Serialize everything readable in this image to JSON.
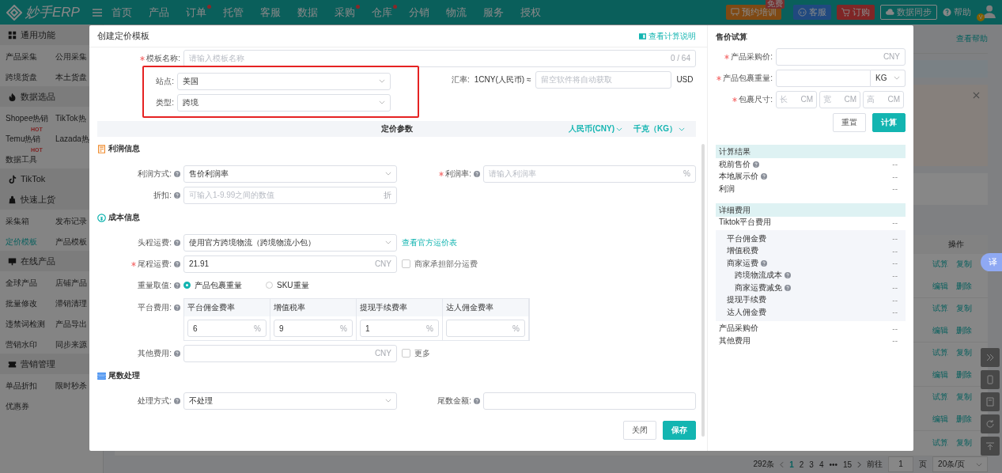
{
  "topbar": {
    "logo": "妙手ERP",
    "nav": [
      {
        "label": "首页",
        "dot": false
      },
      {
        "label": "产品",
        "dot": false
      },
      {
        "label": "订单",
        "dot": true
      },
      {
        "label": "托管",
        "dot": false
      },
      {
        "label": "客服",
        "dot": false
      },
      {
        "label": "数据",
        "dot": false
      },
      {
        "label": "采购",
        "dot": true
      },
      {
        "label": "仓库",
        "dot": true
      },
      {
        "label": "分销",
        "dot": false
      },
      {
        "label": "物流",
        "dot": false
      },
      {
        "label": "服务",
        "dot": false
      },
      {
        "label": "授权",
        "dot": false
      }
    ],
    "training": {
      "label": "预约培训",
      "badge": "免费"
    },
    "service": "客服",
    "order": "订购",
    "sync": "数据同步",
    "help": "帮助",
    "avatar_badge": "V"
  },
  "sidebar": [
    {
      "title": "通用功能",
      "items": [
        {
          "label": "产品采集",
          "selected": false
        },
        {
          "label": "公用采集",
          "selected": false
        },
        {
          "label": "跨境货盘",
          "selected": false
        },
        {
          "label": "本土货盘",
          "selected": false
        }
      ]
    },
    {
      "title": "数据选品",
      "items": [
        {
          "label": "Shopee热销",
          "selected": false
        },
        {
          "label": "TikTok热",
          "selected": false
        },
        {
          "label": "Temu热销",
          "selected": false,
          "badge": "HOT"
        },
        {
          "label": "Lazada热",
          "selected": false
        },
        {
          "label": "数据工具",
          "selected": false,
          "badge": "HOT"
        }
      ]
    },
    {
      "title": "TikTok"
    },
    {
      "title": "快速上货",
      "items": [
        {
          "label": "采集箱",
          "selected": false
        },
        {
          "label": "发布记录",
          "selected": false
        },
        {
          "label": "定价模板",
          "selected": true
        },
        {
          "label": "产品模板",
          "selected": false
        }
      ]
    },
    {
      "title": "在线产品",
      "items": [
        {
          "label": "全球产品",
          "selected": false
        },
        {
          "label": "店铺产品",
          "selected": false
        },
        {
          "label": "批量修改",
          "selected": false
        },
        {
          "label": "滞销清理",
          "selected": false
        },
        {
          "label": "违禁词检测",
          "selected": false
        },
        {
          "label": "产品导出",
          "selected": false
        },
        {
          "label": "营销水印",
          "selected": false
        },
        {
          "label": "同步来源",
          "selected": false
        }
      ]
    },
    {
      "title": "营销管理",
      "items": [
        {
          "label": "单品折扣",
          "selected": false
        },
        {
          "label": "限时秒杀",
          "selected": false
        },
        {
          "label": "优惠券",
          "selected": false
        }
      ]
    }
  ],
  "background": {
    "help_link": "查看帮助",
    "action_header": "操作",
    "rows": [
      {
        "actions": [
          "试算",
          "复制",
          "编辑",
          "删除"
        ]
      },
      {
        "actions": [
          "试算",
          "复制",
          "编辑",
          "删除"
        ]
      },
      {
        "actions": [
          "试算",
          "复制",
          "编辑",
          "删除"
        ]
      },
      {
        "actions": [
          "试算",
          "复制",
          "编辑",
          "删除"
        ]
      },
      {
        "actions": [
          "试算",
          "复制"
        ]
      }
    ],
    "pagination": {
      "total": "292条",
      "pages": [
        {
          "label": "1",
          "selected": true
        },
        {
          "label": "2",
          "selected": false
        },
        {
          "label": "3",
          "selected": false
        },
        {
          "label": "4",
          "selected": false
        }
      ],
      "ellipsis": "•••",
      "last": "15",
      "goto": "前往",
      "page_input": "1",
      "page_unit": "页",
      "page_size": "20条/页"
    },
    "translate": "译"
  },
  "modal": {
    "title": "创建定价模板",
    "help_link": "查看计算说明",
    "name_field": {
      "label": "模板名称:",
      "required": true,
      "placeholder": "请输入模板名称",
      "counter": "0 / 64"
    },
    "site": {
      "label": "站点:",
      "value": "美国"
    },
    "type": {
      "label": "类型:",
      "value": "跨境"
    },
    "rate": {
      "label": "汇率:",
      "text": "1CNY(人民币) ≈",
      "placeholder": "留空软件将自动获取",
      "unit": "USD"
    },
    "params": {
      "title": "定价参数",
      "currency": "人民币(CNY)",
      "weight_unit": "千克（KG）"
    },
    "sections": [
      {
        "title": "利润信息",
        "rows": [
          [
            {
              "kind": "select",
              "label": "利润方式:",
              "help": true,
              "required": false,
              "value": "售价利润率"
            },
            {
              "kind": "input",
              "label": "利润率:",
              "help": true,
              "required": true,
              "placeholder": "请输入利润率",
              "suffix": "%"
            }
          ],
          [
            {
              "kind": "input",
              "label": "折扣:",
              "help": true,
              "required": false,
              "placeholder": "可输入1-9.99之间的数值",
              "suffix": "折"
            }
          ]
        ]
      },
      {
        "title": "成本信息",
        "rows": [
          [
            {
              "kind": "select",
              "label": "头程运费:",
              "help": true,
              "required": false,
              "value": "使用官方跨境物流（跨境物流小包）",
              "link": "查看官方运价表"
            }
          ],
          [
            {
              "kind": "input",
              "label": "尾程运费:",
              "help": true,
              "required": true,
              "value": "21.91",
              "suffix": "CNY",
              "checkbox": {
                "label": "商家承担部分运费",
                "checked": false
              }
            }
          ],
          [
            {
              "kind": "radio",
              "label": "重量取值:",
              "help": true,
              "required": false,
              "options": [
                {
                  "label": "产品包裹重量",
                  "selected": true
                },
                {
                  "label": "SKU重量",
                  "selected": false
                }
              ]
            }
          ],
          [
            {
              "kind": "fees",
              "label": "平台费用:",
              "help": true,
              "required": false,
              "columns": [
                {
                  "title": "平台佣金费率",
                  "value": "6",
                  "suffix": "%"
                },
                {
                  "title": "增值税率",
                  "value": "9",
                  "suffix": "%"
                },
                {
                  "title": "提现手续费率",
                  "value": "1",
                  "suffix": "%"
                },
                {
                  "title": "达人佣金费率",
                  "suffix": "%"
                }
              ]
            }
          ],
          [
            {
              "kind": "input",
              "label": "其他费用:",
              "help": true,
              "required": false,
              "suffix": "CNY",
              "checkbox": {
                "label": "更多",
                "checked": false
              }
            }
          ]
        ]
      },
      {
        "title": "尾数处理",
        "rows": [
          [
            {
              "kind": "select",
              "label": "处理方式:",
              "help": true,
              "required": false,
              "value": "不处理"
            },
            {
              "kind": "input",
              "label": "尾数金额:",
              "help": true,
              "required": false
            }
          ]
        ]
      }
    ],
    "close": "关闭",
    "save": "保存"
  },
  "calc": {
    "title": "售价试算",
    "purchase": {
      "label": "产品采购价:",
      "required": true,
      "unit": "CNY"
    },
    "weight": {
      "label": "产品包裹重量:",
      "required": true,
      "unit": "KG"
    },
    "size": {
      "label": "包裹尺寸:",
      "required": true,
      "dims": [
        {
          "placeholder": "长",
          "unit": "CM"
        },
        {
          "placeholder": "宽",
          "unit": "CM"
        },
        {
          "placeholder": "高",
          "unit": "CM"
        }
      ]
    },
    "reset": "重置",
    "calculate": "计算",
    "result_title": "计算结果",
    "results": [
      {
        "label": "税前售价",
        "help": true,
        "value": "--"
      },
      {
        "label": "本地展示价",
        "help": true,
        "value": "--"
      },
      {
        "label": "利润",
        "help": false,
        "value": "--"
      }
    ],
    "detail_title": "详细费用",
    "platform": {
      "label": "Tiktok平台费用",
      "value": "--"
    },
    "platform_items": [
      {
        "label": "平台佣金费",
        "help": false,
        "value": "--"
      },
      {
        "label": "增值税费",
        "help": false,
        "value": "--"
      },
      {
        "label": "商家运费",
        "help": true,
        "value": "--",
        "children": [
          {
            "label": "跨境物流成本",
            "help": true,
            "value": "--"
          },
          {
            "label": "商家运费减免",
            "help": true,
            "value": "--"
          }
        ]
      },
      {
        "label": "提现手续费",
        "help": false,
        "value": "--"
      },
      {
        "label": "达人佣金费",
        "help": false,
        "value": "--"
      }
    ],
    "others": [
      {
        "label": "产品采购价",
        "value": "--"
      },
      {
        "label": "其他费用",
        "value": "--"
      }
    ]
  }
}
